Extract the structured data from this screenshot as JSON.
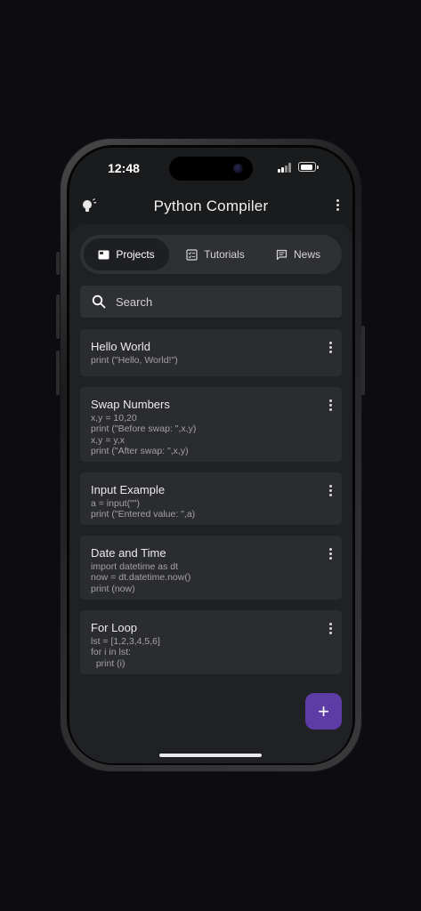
{
  "status_bar": {
    "time": "12:48"
  },
  "app_bar": {
    "title": "Python Compiler",
    "theme_icon": "lightbulb-icon",
    "menu_icon": "more-vert-icon"
  },
  "tabs": [
    {
      "label": "Projects",
      "icon": "folder-icon",
      "active": true
    },
    {
      "label": "Tutorials",
      "icon": "checklist-icon",
      "active": false
    },
    {
      "label": "News",
      "icon": "chat-icon",
      "active": false
    }
  ],
  "search": {
    "placeholder": "Search",
    "value": ""
  },
  "projects": [
    {
      "title": "Hello World",
      "code": "print (\"Hello, World!\")"
    },
    {
      "title": "Swap Numbers",
      "code": "x,y = 10,20\nprint (\"Before swap: \",x,y)\nx,y = y,x\nprint (\"After swap: \",x,y)"
    },
    {
      "title": "Input Example",
      "code": "a = input(\"\")\nprint (\"Entered value: \",a)"
    },
    {
      "title": "Date and Time",
      "code": "import datetime as dt\nnow = dt.datetime.now()\nprint (now)"
    },
    {
      "title": "For Loop",
      "code": "lst = [1,2,3,4,5,6]\nfor i in lst:\n  print (i)"
    }
  ],
  "fab": {
    "label": "+"
  },
  "colors": {
    "background": "#0d0c10",
    "surface": "#202124",
    "card": "#2b2c30",
    "accent": "#5e3ca6"
  }
}
